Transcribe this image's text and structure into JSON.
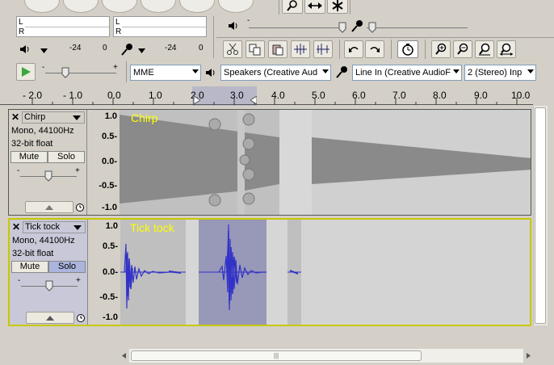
{
  "meters": {
    "play_channels": [
      "L",
      "R"
    ],
    "rec_channels": [
      "L",
      "R"
    ],
    "play_scale": [
      "-24",
      "0"
    ],
    "rec_scale": [
      "-24",
      "0"
    ]
  },
  "device": {
    "host": "MME",
    "output": "Speakers (Creative Aud",
    "input": "Line In (Creative AudioF",
    "channels": "2 (Stereo) Inp"
  },
  "ruler": {
    "ticks": [
      "- 2.0",
      "- 1.0",
      "0.0",
      "1.0",
      "2.0",
      "3.0",
      "4.0",
      "5.0",
      "6.0",
      "7.0",
      "8.0",
      "9.0",
      "10.0"
    ]
  },
  "tracks": [
    {
      "name": "Chirp",
      "overlay_label": "Chirp",
      "format": "Mono, 44100Hz",
      "bitdepth": "32-bit float",
      "mute": "Mute",
      "solo": "Solo",
      "scale": [
        "1.0",
        "0.5-",
        "0.0-",
        "-0.5-",
        "-1.0"
      ],
      "selected": false
    },
    {
      "name": "Tick tock",
      "overlay_label": "Tick tock",
      "format": "Mono, 44100Hz",
      "bitdepth": "32-bit float",
      "mute": "Mute",
      "solo": "Solo",
      "scale": [
        "1.0",
        "0.5-",
        "0.0-",
        "-0.5-",
        "-1.0"
      ],
      "selected": true
    }
  ],
  "scrollbar_grip": "|||",
  "colors": {
    "background": "#d4d0c8",
    "waveform_blue": "#3232c8",
    "waveform_gray": "#8a8a8a",
    "selection": "#9898b8",
    "label_yellow": "#ffff00"
  }
}
